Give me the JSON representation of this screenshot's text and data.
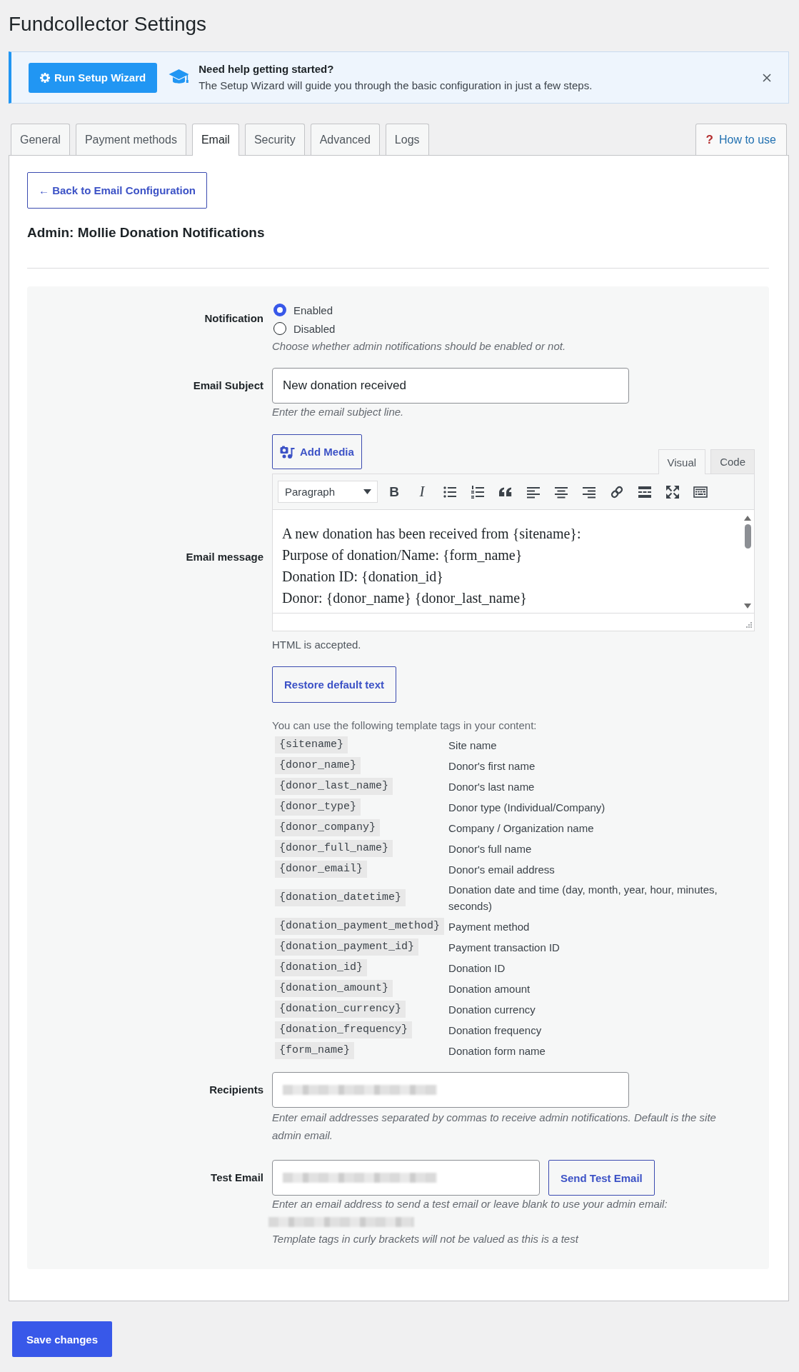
{
  "page": {
    "title": "Fundcollector Settings"
  },
  "banner": {
    "button": "Run Setup Wizard",
    "heading": "Need help getting started?",
    "text": "The Setup Wizard will guide you through the basic configuration in just a few steps."
  },
  "tabs": [
    {
      "label": "General",
      "selected": false
    },
    {
      "label": "Payment methods",
      "selected": false
    },
    {
      "label": "Email",
      "selected": true
    },
    {
      "label": "Security",
      "selected": false
    },
    {
      "label": "Advanced",
      "selected": false
    },
    {
      "label": "Logs",
      "selected": false
    }
  ],
  "help_link": {
    "icon": "?",
    "label": "How to use"
  },
  "back_button": "← Back to Email Configuration",
  "heading": "Admin: Mollie Donation Notifications",
  "form": {
    "notification": {
      "label": "Notification",
      "options": [
        {
          "label": "Enabled",
          "selected": true
        },
        {
          "label": "Disabled",
          "selected": false
        }
      ],
      "description": "Choose whether admin notifications should be enabled or not."
    },
    "subject": {
      "label": "Email Subject",
      "value": "New donation received",
      "description": "Enter the email subject line."
    },
    "message": {
      "label": "Email message",
      "add_media": "Add Media",
      "modes": [
        {
          "label": "Visual",
          "selected": true
        },
        {
          "label": "Code",
          "selected": false
        }
      ],
      "format": "Paragraph",
      "toolbar": [
        {
          "kind": "bold",
          "text": "B"
        },
        {
          "kind": "italic",
          "text": "I"
        },
        {
          "kind": "bullet-list"
        },
        {
          "kind": "numbered-list"
        },
        {
          "kind": "quote"
        },
        {
          "kind": "align-left"
        },
        {
          "kind": "align-center"
        },
        {
          "kind": "align-right"
        },
        {
          "kind": "link"
        },
        {
          "kind": "read-more"
        },
        {
          "kind": "fullscreen"
        },
        {
          "kind": "toolbar-toggle"
        }
      ],
      "content": [
        "A new donation has been received from {sitename}:",
        "Purpose of donation/Name: {form_name}",
        "Donation ID: {donation_id}",
        "Donor: {donor_name} {donor_last_name}"
      ],
      "note": "HTML is accepted.",
      "restore_button": "Restore default text",
      "tags_intro": "You can use the following template tags in your content:",
      "tags": [
        {
          "tag": "{sitename}",
          "description": "Site name"
        },
        {
          "tag": "{donor_name}",
          "description": "Donor's first name"
        },
        {
          "tag": "{donor_last_name}",
          "description": "Donor's last name"
        },
        {
          "tag": "{donor_type}",
          "description": "Donor type (Individual/Company)"
        },
        {
          "tag": "{donor_company}",
          "description": "Company / Organization name"
        },
        {
          "tag": "{donor_full_name}",
          "description": "Donor's full name"
        },
        {
          "tag": "{donor_email}",
          "description": "Donor's email address"
        },
        {
          "tag": "{donation_datetime}",
          "description": "Donation date and time (day, month, year, hour, minutes, seconds)"
        },
        {
          "tag": "{donation_payment_method}",
          "description": "Payment method"
        },
        {
          "tag": "{donation_payment_id}",
          "description": "Payment transaction ID"
        },
        {
          "tag": "{donation_id}",
          "description": "Donation ID"
        },
        {
          "tag": "{donation_amount}",
          "description": "Donation amount"
        },
        {
          "tag": "{donation_currency}",
          "description": "Donation currency"
        },
        {
          "tag": "{donation_frequency}",
          "description": "Donation frequency"
        },
        {
          "tag": "{form_name}",
          "description": "Donation form name"
        }
      ]
    },
    "recipients": {
      "label": "Recipients",
      "description": "Enter email addresses separated by commas to receive admin notifications. Default is the site admin email."
    },
    "test_email": {
      "label": "Test Email",
      "button": "Send Test Email",
      "description": "Enter an email address to send a test email or leave blank to use your admin email:",
      "note": "Template tags in curly brackets will not be valued as this is a test"
    }
  },
  "save_button": "Save changes"
}
